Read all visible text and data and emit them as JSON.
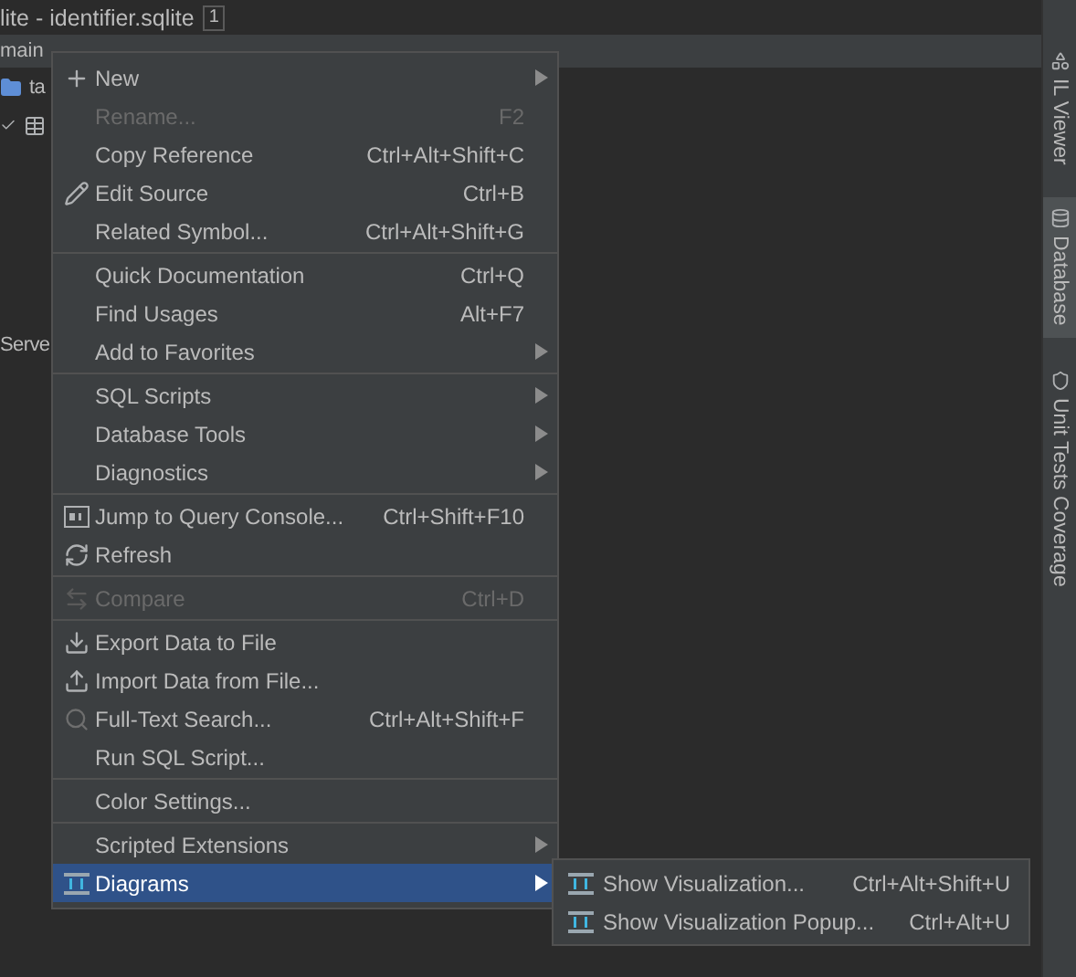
{
  "window": {
    "title": "lite - identifier.sqlite",
    "badge": "1"
  },
  "header": {
    "label": "main"
  },
  "tree": [
    {
      "label": "ta"
    },
    {
      "kind": "table"
    },
    {
      "label": "Serve"
    }
  ],
  "sidebar": {
    "tabs": [
      {
        "label": "IL Viewer",
        "selected": false
      },
      {
        "label": "Database",
        "selected": true
      },
      {
        "label": "Unit Tests Coverage",
        "selected": false
      }
    ]
  },
  "menu": {
    "groups": [
      [
        {
          "label": "New",
          "submenu": true,
          "disabled": false,
          "selected": false
        },
        {
          "label": "Rename...",
          "shortcut": "F2",
          "submenu": false,
          "disabled": true,
          "selected": false
        },
        {
          "label": "Copy Reference",
          "shortcut": "Ctrl+Alt+Shift+C",
          "submenu": false,
          "disabled": false,
          "selected": false
        },
        {
          "label": "Edit Source",
          "shortcut": "Ctrl+B",
          "submenu": false,
          "disabled": false,
          "selected": false
        },
        {
          "label": "Related Symbol...",
          "shortcut": "Ctrl+Alt+Shift+G",
          "submenu": false,
          "disabled": false,
          "selected": false
        }
      ],
      [
        {
          "label": "Quick Documentation",
          "shortcut": "Ctrl+Q",
          "submenu": false,
          "disabled": false,
          "selected": false
        },
        {
          "label": "Find Usages",
          "shortcut": "Alt+F7",
          "submenu": false,
          "disabled": false,
          "selected": false
        },
        {
          "label": "Add to Favorites",
          "submenu": true,
          "disabled": false,
          "selected": false
        }
      ],
      [
        {
          "label": "SQL Scripts",
          "submenu": true,
          "disabled": false,
          "selected": false
        },
        {
          "label": "Database Tools",
          "submenu": true,
          "disabled": false,
          "selected": false
        },
        {
          "label": "Diagnostics",
          "submenu": true,
          "disabled": false,
          "selected": false
        }
      ],
      [
        {
          "label": "Jump to Query Console...",
          "shortcut": "Ctrl+Shift+F10",
          "submenu": false,
          "disabled": false,
          "selected": false
        },
        {
          "label": "Refresh",
          "submenu": false,
          "disabled": false,
          "selected": false
        }
      ],
      [
        {
          "label": "Compare",
          "shortcut": "Ctrl+D",
          "submenu": false,
          "disabled": true,
          "selected": false
        }
      ],
      [
        {
          "label": "Export Data to File",
          "submenu": false,
          "disabled": false,
          "selected": false
        },
        {
          "label": "Import Data from File...",
          "submenu": false,
          "disabled": false,
          "selected": false
        },
        {
          "label": "Full-Text Search...",
          "shortcut": "Ctrl+Alt+Shift+F",
          "submenu": false,
          "disabled": false,
          "selected": false
        },
        {
          "label": "Run SQL Script...",
          "submenu": false,
          "disabled": false,
          "selected": false
        }
      ],
      [
        {
          "label": "Color Settings...",
          "submenu": false,
          "disabled": false,
          "selected": false
        }
      ],
      [
        {
          "label": "Scripted Extensions",
          "submenu": true,
          "disabled": false,
          "selected": false
        },
        {
          "label": "Diagrams",
          "submenu": true,
          "disabled": false,
          "selected": true
        }
      ]
    ]
  },
  "submenu": {
    "items": [
      {
        "label": "Show Visualization...",
        "shortcut": "Ctrl+Alt+Shift+U"
      },
      {
        "label": "Show Visualization Popup...",
        "shortcut": "Ctrl+Alt+U"
      }
    ]
  }
}
